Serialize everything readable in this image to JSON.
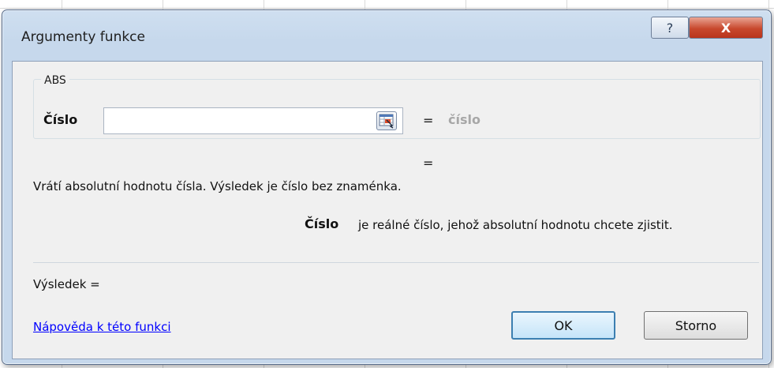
{
  "dialog": {
    "title": "Argumenty funkce",
    "help_icon": "?",
    "close_icon": "X"
  },
  "function": {
    "name": "ABS",
    "arg_label": "Číslo",
    "arg_value": "",
    "equals": "=",
    "arg_hint": "číslo",
    "result_equals": "=",
    "description": "Vrátí absolutní hodnotu čísla. Výsledek je číslo bez znaménka.",
    "arg_desc_label": "Číslo",
    "arg_desc": "je reálné číslo, jehož absolutní hodnotu chcete zjistit."
  },
  "footer": {
    "result_label": "Výsledek =",
    "help_link": "Nápověda k této funkci",
    "ok_label": "OK",
    "cancel_label": "Storno"
  },
  "icons": {
    "pick_range": "collapse-dialog-icon"
  }
}
